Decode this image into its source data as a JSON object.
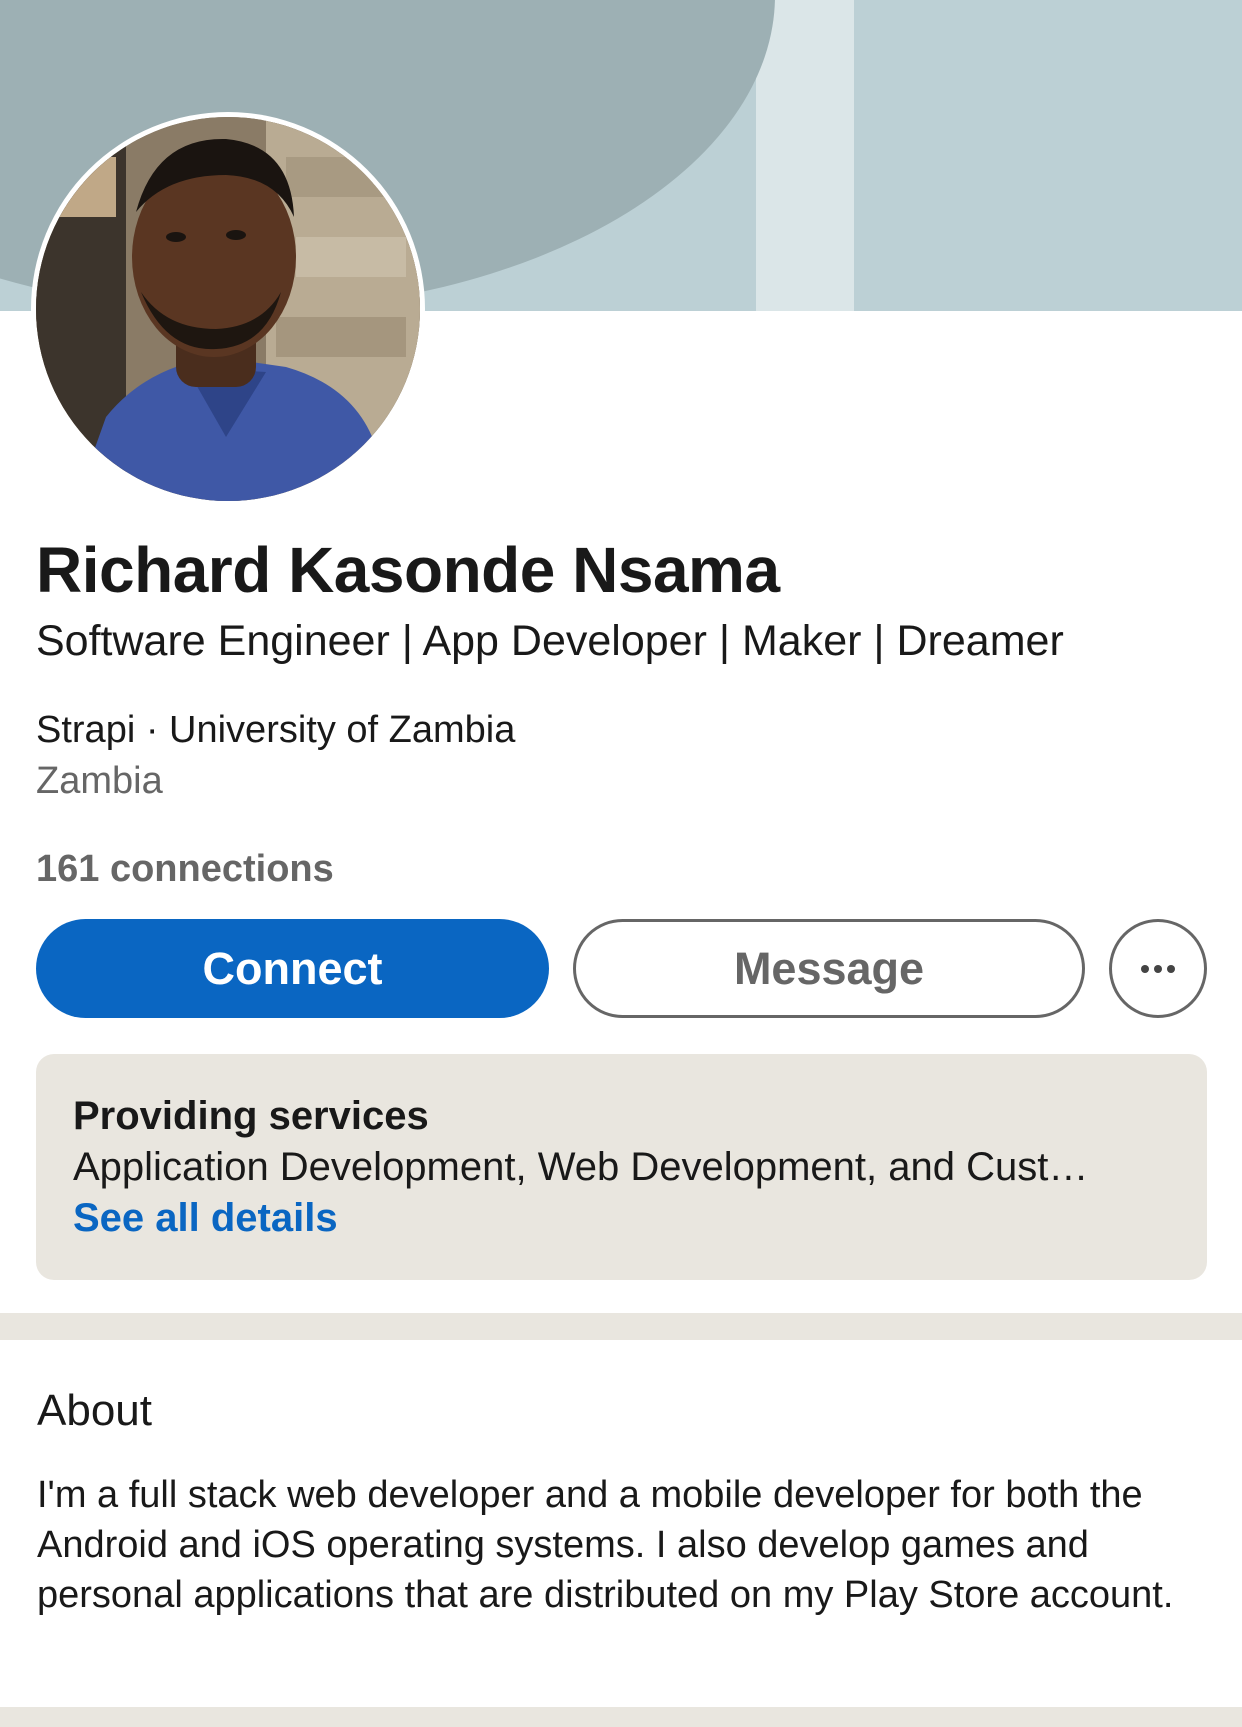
{
  "profile": {
    "name": "Richard Kasonde Nsama",
    "headline": "Software Engineer | App Developer | Maker | Dreamer",
    "organization": "Strapi · University of Zambia",
    "location": "Zambia",
    "connections": "161 connections"
  },
  "actions": {
    "connect_label": "Connect",
    "message_label": "Message",
    "more_icon": "more-horizontal-icon"
  },
  "services": {
    "title": "Providing services",
    "list": "Application Development, Web Development, and Cust…",
    "link": "See all details"
  },
  "about": {
    "title": "About",
    "text": "I'm a full stack web developer and a mobile developer for both the Android and iOS operating systems. I also develop games and personal applications that are distributed on my Play Store account."
  },
  "colors": {
    "brand_blue": "#0a66c2",
    "banner_light": "#bcd0d5",
    "banner_dark": "#9db0b4",
    "page_background": "#e9e6df"
  }
}
